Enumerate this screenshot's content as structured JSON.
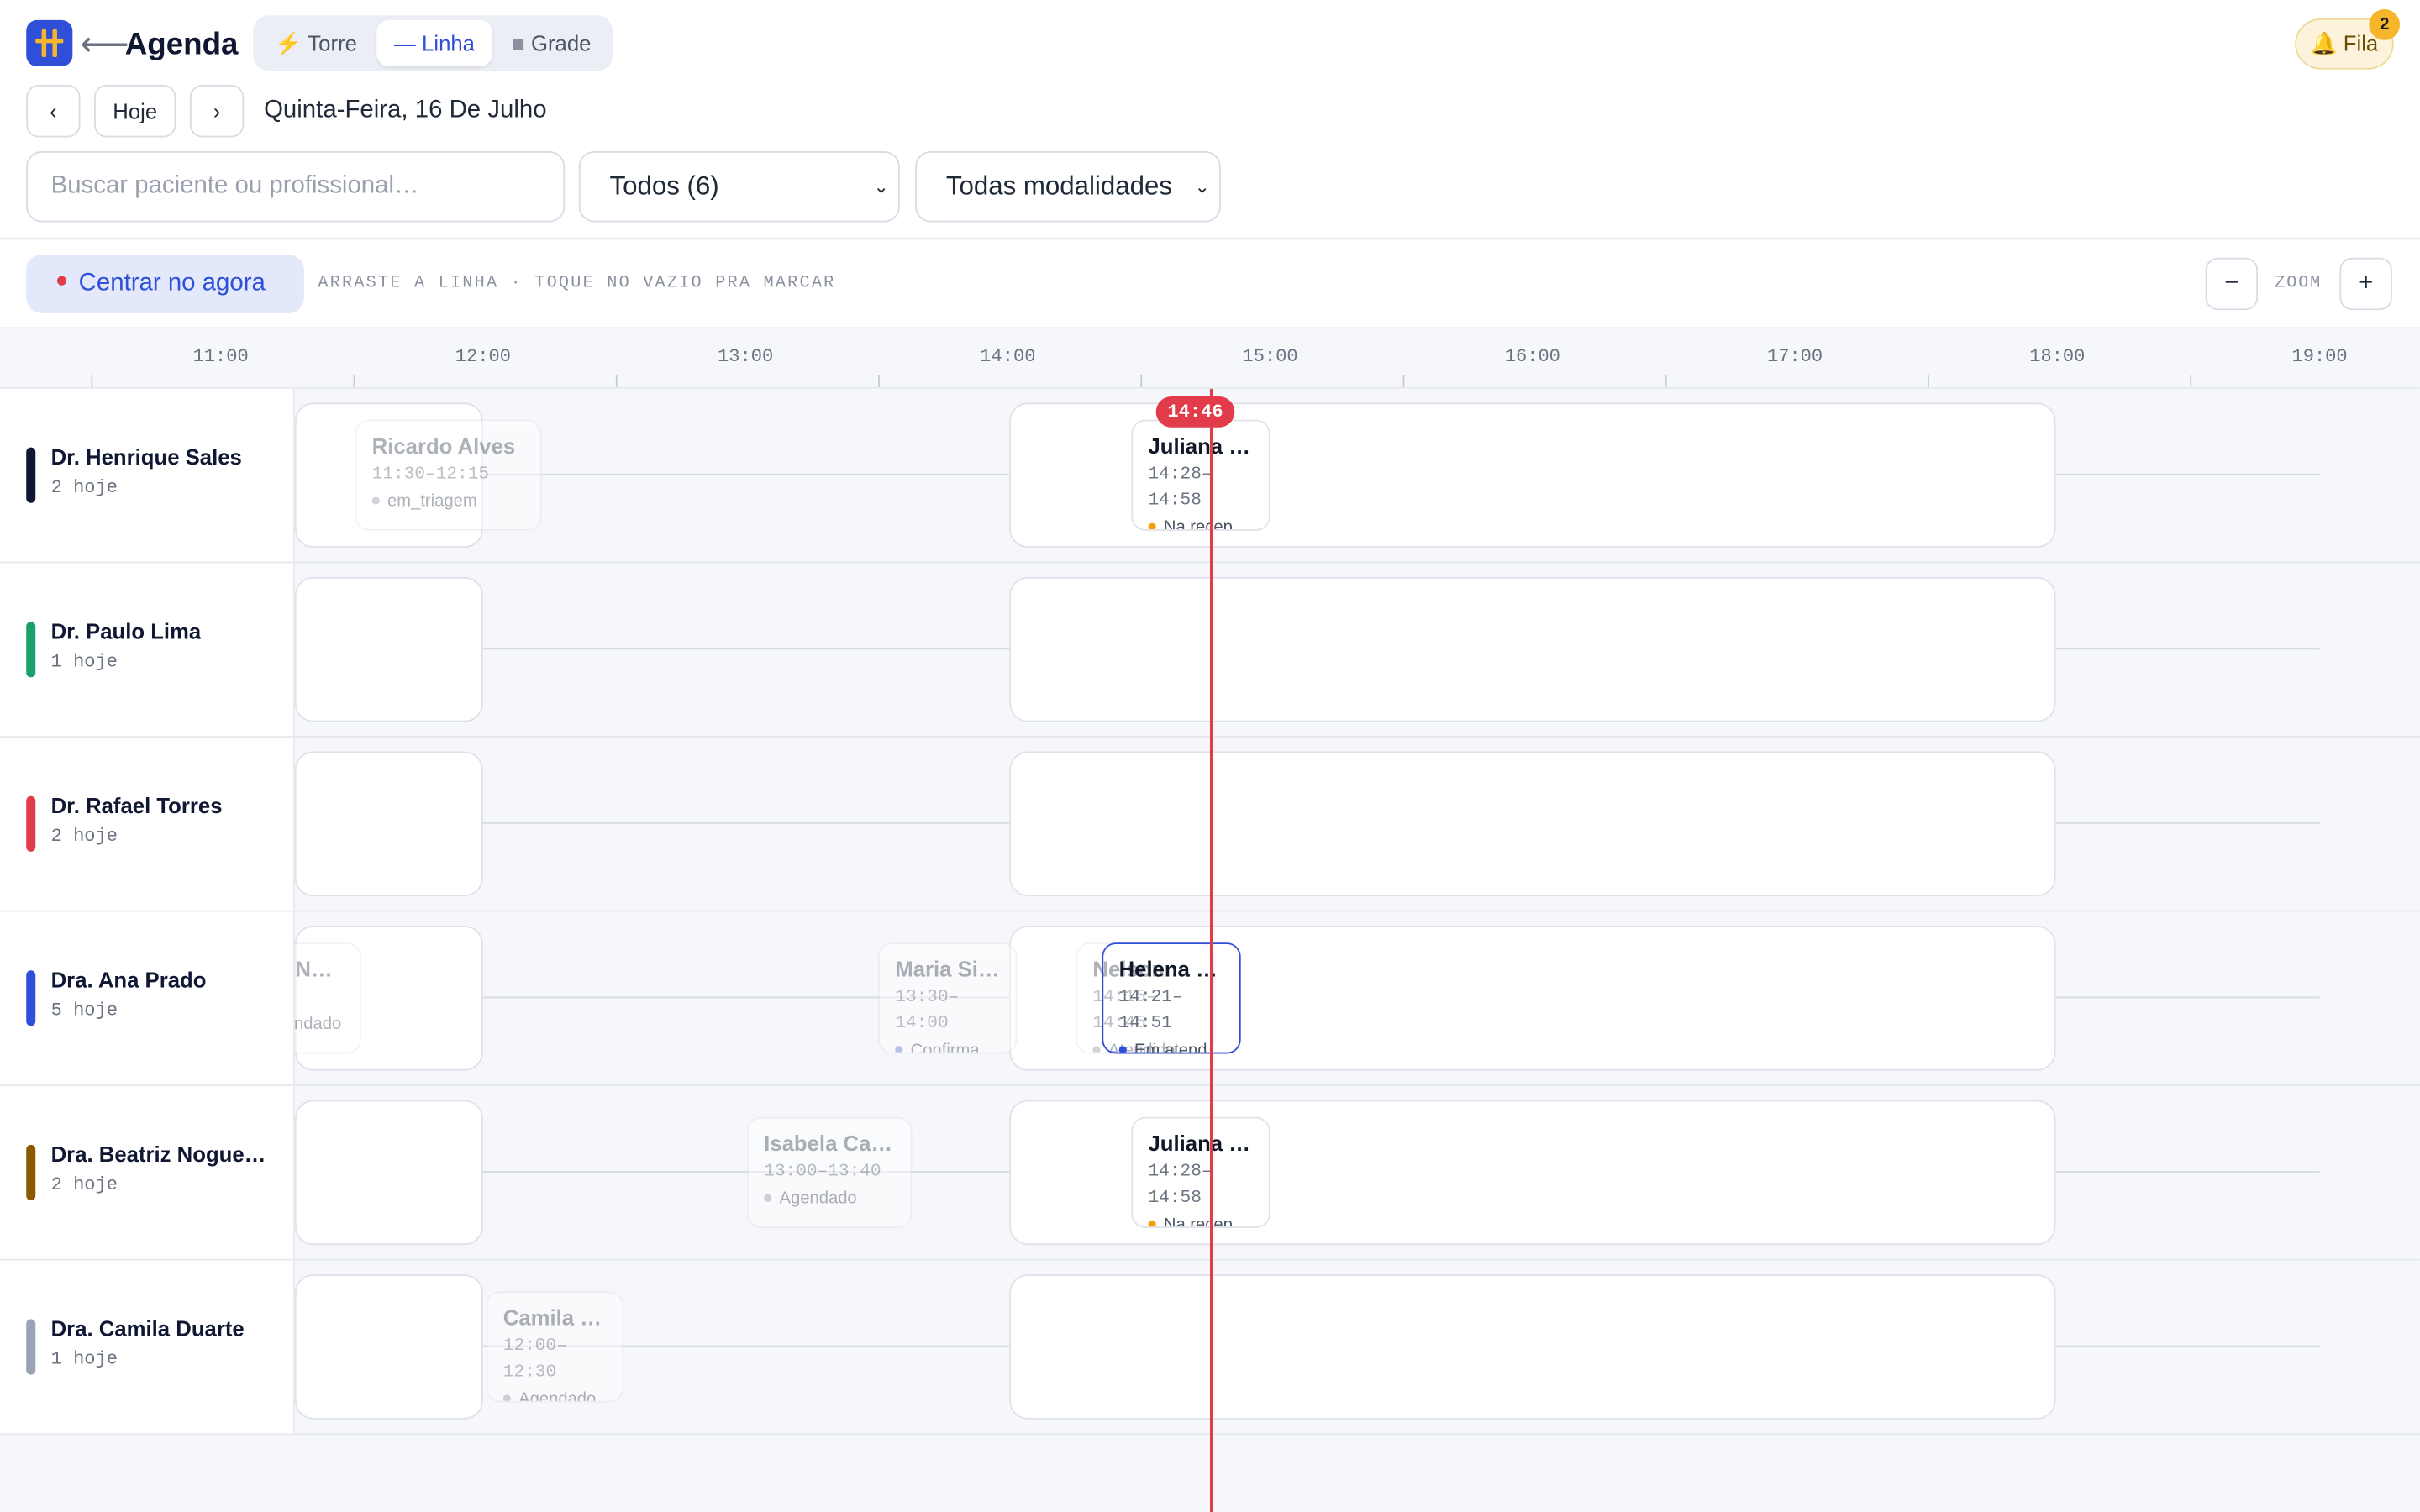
{
  "header": {
    "title": "Agenda",
    "back_icon": "arrow-left-icon",
    "views": [
      {
        "label": "Torre",
        "icon": "⚡",
        "active": false
      },
      {
        "label": "Linha",
        "icon": "—",
        "active": true
      },
      {
        "label": "Grade",
        "icon": "■",
        "active": false
      }
    ],
    "queue_label": "Fila",
    "queue_count": "2"
  },
  "date_nav": {
    "prev": "‹",
    "today": "Hoje",
    "next": "›",
    "date_label": "Quinta-Feira, 16 De Julho"
  },
  "filters": {
    "search_placeholder": "Buscar paciente ou profissional…",
    "professional_select": "Todos (6)",
    "modality_select": "Todas modalidades"
  },
  "toolbar": {
    "center_now": "Centrar no agora",
    "hint": "ARRASTE A LINHA · TOQUE NO VAZIO PRA MARCAR",
    "zoom_out": "−",
    "zoom_label": "ZOOM",
    "zoom_in": "+"
  },
  "timeline": {
    "hours": [
      "11:00",
      "12:00",
      "13:00",
      "14:00",
      "15:00",
      "16:00",
      "17:00",
      "18:00",
      "19:00"
    ],
    "now_label": "14:46"
  },
  "colors": {
    "accent": "#2f4fd8",
    "now": "#e23b4a",
    "queue_bg": "#fdf3dc"
  },
  "professionals": [
    {
      "name": "Dr. Henrique Sales",
      "count": "2 hoje",
      "color": "#0f1733",
      "appointments": [
        {
          "patient": "Ricardo Alves",
          "time": "11:30–12:15",
          "status": "em_triagem",
          "status_color": "#9aa0ad",
          "faded": true
        },
        {
          "patient": "Juliana …",
          "time": "14:28–\n14:58",
          "status": "Na recep",
          "status_color": "#f59e0b",
          "faded": false
        }
      ]
    },
    {
      "name": "Dr. Paulo Lima",
      "count": "1 hoje",
      "color": "#1aa06b",
      "appointments": []
    },
    {
      "name": "Dr. Rafael Torres",
      "count": "2 hoje",
      "color": "#e23b4a",
      "appointments": []
    },
    {
      "name": "Dra. Ana Prado",
      "count": "5 hoje",
      "color": "#2f4fd8",
      "appointments": [
        {
          "patient": "Ana N…",
          "time": "–",
          "status": "Agendado",
          "status_color": "#9aa0ad",
          "faded": true
        },
        {
          "patient": "Maria Sil…",
          "time": "13:30–\n14:00",
          "status": "Confirma",
          "status_color": "#6b7fd8",
          "faded": true
        },
        {
          "patient": "Nelson T…",
          "time": "14:15–\n14:45",
          "status": "Atendido",
          "status_color": "#9aa0ad",
          "faded": true
        },
        {
          "patient": "Helena …",
          "time": "14:21–\n14:51",
          "status": "Em atend",
          "status_color": "#2f4fd8",
          "faded": false
        }
      ]
    },
    {
      "name": "Dra. Beatriz Nogue…",
      "count": "2 hoje",
      "color": "#8a5a00",
      "appointments": [
        {
          "patient": "Isabela Car…",
          "time": "13:00–13:40",
          "status": "Agendado",
          "status_color": "#9aa0ad",
          "faded": true
        },
        {
          "patient": "Juliana …",
          "time": "14:28–\n14:58",
          "status": "Na recep",
          "status_color": "#f59e0b",
          "faded": false
        }
      ]
    },
    {
      "name": "Dra. Camila Duarte",
      "count": "1 hoje",
      "color": "#9aa3b5",
      "appointments": [
        {
          "patient": "Camila F…",
          "time": "12:00–\n12:30",
          "status": "Agendado",
          "status_color": "#9aa0ad",
          "faded": true
        }
      ]
    }
  ]
}
